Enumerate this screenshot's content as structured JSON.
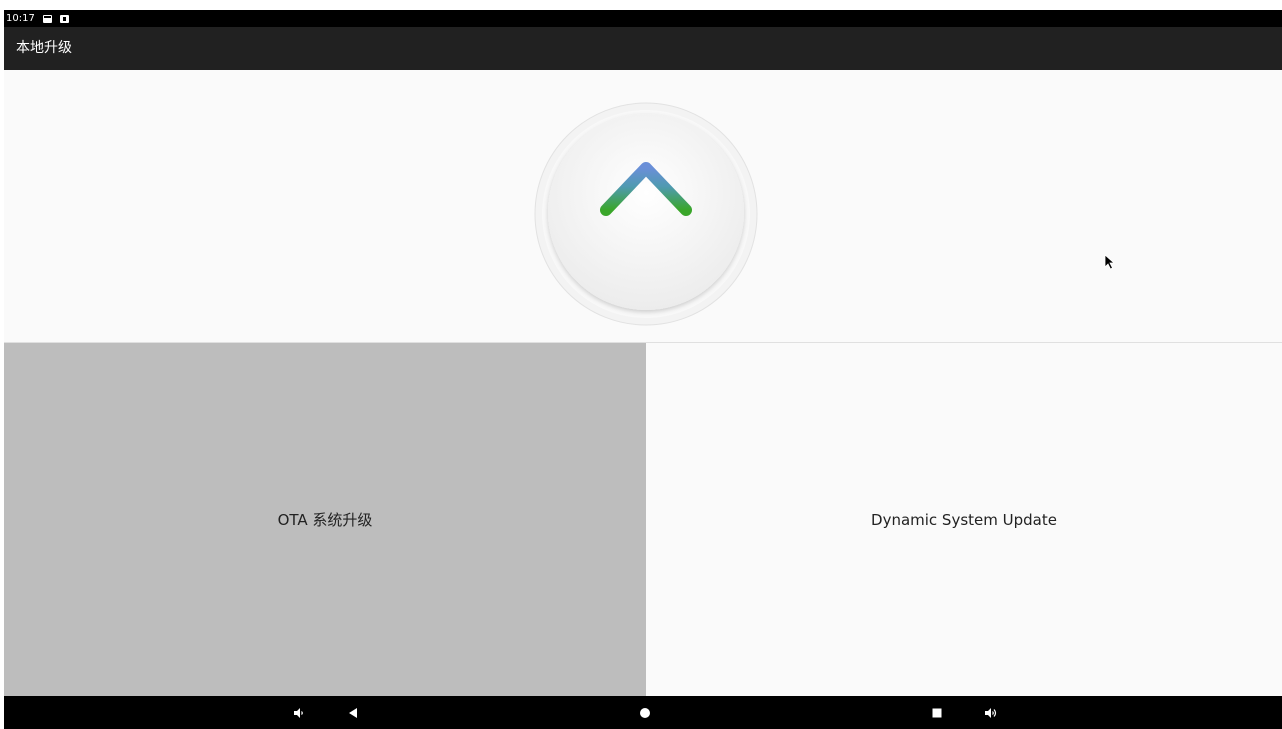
{
  "status_bar": {
    "time": "10:17",
    "icons": [
      "image-notification-icon",
      "sd-card-icon"
    ]
  },
  "app_bar": {
    "title": "本地升级"
  },
  "upgrade_icon": {
    "name": "upload-arrow-icon",
    "gradient_top": "#6a8fd8",
    "gradient_bottom": "#3aa62a"
  },
  "buttons": {
    "ota_label": "OTA 系统升级",
    "dsu_label": "Dynamic System Update",
    "ota_color": "#bdbdbd",
    "dsu_color": "#fafafa"
  },
  "nav_bar": {
    "items": [
      "volume-down-icon",
      "back-icon",
      "home-icon",
      "recents-icon",
      "volume-up-icon"
    ]
  }
}
